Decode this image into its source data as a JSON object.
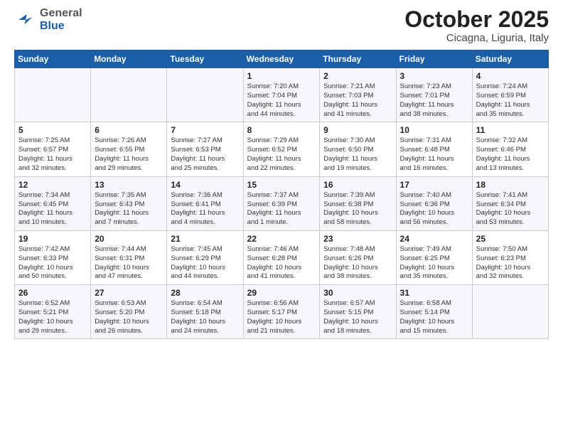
{
  "header": {
    "logo_general": "General",
    "logo_blue": "Blue",
    "month": "October 2025",
    "location": "Cicagna, Liguria, Italy"
  },
  "weekdays": [
    "Sunday",
    "Monday",
    "Tuesday",
    "Wednesday",
    "Thursday",
    "Friday",
    "Saturday"
  ],
  "weeks": [
    [
      {
        "day": "",
        "info": ""
      },
      {
        "day": "",
        "info": ""
      },
      {
        "day": "",
        "info": ""
      },
      {
        "day": "1",
        "info": "Sunrise: 7:20 AM\nSunset: 7:04 PM\nDaylight: 11 hours\nand 44 minutes."
      },
      {
        "day": "2",
        "info": "Sunrise: 7:21 AM\nSunset: 7:03 PM\nDaylight: 11 hours\nand 41 minutes."
      },
      {
        "day": "3",
        "info": "Sunrise: 7:23 AM\nSunset: 7:01 PM\nDaylight: 11 hours\nand 38 minutes."
      },
      {
        "day": "4",
        "info": "Sunrise: 7:24 AM\nSunset: 6:59 PM\nDaylight: 11 hours\nand 35 minutes."
      }
    ],
    [
      {
        "day": "5",
        "info": "Sunrise: 7:25 AM\nSunset: 6:57 PM\nDaylight: 11 hours\nand 32 minutes."
      },
      {
        "day": "6",
        "info": "Sunrise: 7:26 AM\nSunset: 6:55 PM\nDaylight: 11 hours\nand 29 minutes."
      },
      {
        "day": "7",
        "info": "Sunrise: 7:27 AM\nSunset: 6:53 PM\nDaylight: 11 hours\nand 25 minutes."
      },
      {
        "day": "8",
        "info": "Sunrise: 7:29 AM\nSunset: 6:52 PM\nDaylight: 11 hours\nand 22 minutes."
      },
      {
        "day": "9",
        "info": "Sunrise: 7:30 AM\nSunset: 6:50 PM\nDaylight: 11 hours\nand 19 minutes."
      },
      {
        "day": "10",
        "info": "Sunrise: 7:31 AM\nSunset: 6:48 PM\nDaylight: 11 hours\nand 16 minutes."
      },
      {
        "day": "11",
        "info": "Sunrise: 7:32 AM\nSunset: 6:46 PM\nDaylight: 11 hours\nand 13 minutes."
      }
    ],
    [
      {
        "day": "12",
        "info": "Sunrise: 7:34 AM\nSunset: 6:45 PM\nDaylight: 11 hours\nand 10 minutes."
      },
      {
        "day": "13",
        "info": "Sunrise: 7:35 AM\nSunset: 6:43 PM\nDaylight: 11 hours\nand 7 minutes."
      },
      {
        "day": "14",
        "info": "Sunrise: 7:36 AM\nSunset: 6:41 PM\nDaylight: 11 hours\nand 4 minutes."
      },
      {
        "day": "15",
        "info": "Sunrise: 7:37 AM\nSunset: 6:39 PM\nDaylight: 11 hours\nand 1 minute."
      },
      {
        "day": "16",
        "info": "Sunrise: 7:39 AM\nSunset: 6:38 PM\nDaylight: 10 hours\nand 58 minutes."
      },
      {
        "day": "17",
        "info": "Sunrise: 7:40 AM\nSunset: 6:36 PM\nDaylight: 10 hours\nand 56 minutes."
      },
      {
        "day": "18",
        "info": "Sunrise: 7:41 AM\nSunset: 6:34 PM\nDaylight: 10 hours\nand 53 minutes."
      }
    ],
    [
      {
        "day": "19",
        "info": "Sunrise: 7:42 AM\nSunset: 6:33 PM\nDaylight: 10 hours\nand 50 minutes."
      },
      {
        "day": "20",
        "info": "Sunrise: 7:44 AM\nSunset: 6:31 PM\nDaylight: 10 hours\nand 47 minutes."
      },
      {
        "day": "21",
        "info": "Sunrise: 7:45 AM\nSunset: 6:29 PM\nDaylight: 10 hours\nand 44 minutes."
      },
      {
        "day": "22",
        "info": "Sunrise: 7:46 AM\nSunset: 6:28 PM\nDaylight: 10 hours\nand 41 minutes."
      },
      {
        "day": "23",
        "info": "Sunrise: 7:48 AM\nSunset: 6:26 PM\nDaylight: 10 hours\nand 38 minutes."
      },
      {
        "day": "24",
        "info": "Sunrise: 7:49 AM\nSunset: 6:25 PM\nDaylight: 10 hours\nand 35 minutes."
      },
      {
        "day": "25",
        "info": "Sunrise: 7:50 AM\nSunset: 6:23 PM\nDaylight: 10 hours\nand 32 minutes."
      }
    ],
    [
      {
        "day": "26",
        "info": "Sunrise: 6:52 AM\nSunset: 5:21 PM\nDaylight: 10 hours\nand 29 minutes."
      },
      {
        "day": "27",
        "info": "Sunrise: 6:53 AM\nSunset: 5:20 PM\nDaylight: 10 hours\nand 26 minutes."
      },
      {
        "day": "28",
        "info": "Sunrise: 6:54 AM\nSunset: 5:18 PM\nDaylight: 10 hours\nand 24 minutes."
      },
      {
        "day": "29",
        "info": "Sunrise: 6:56 AM\nSunset: 5:17 PM\nDaylight: 10 hours\nand 21 minutes."
      },
      {
        "day": "30",
        "info": "Sunrise: 6:57 AM\nSunset: 5:15 PM\nDaylight: 10 hours\nand 18 minutes."
      },
      {
        "day": "31",
        "info": "Sunrise: 6:58 AM\nSunset: 5:14 PM\nDaylight: 10 hours\nand 15 minutes."
      },
      {
        "day": "",
        "info": ""
      }
    ]
  ]
}
